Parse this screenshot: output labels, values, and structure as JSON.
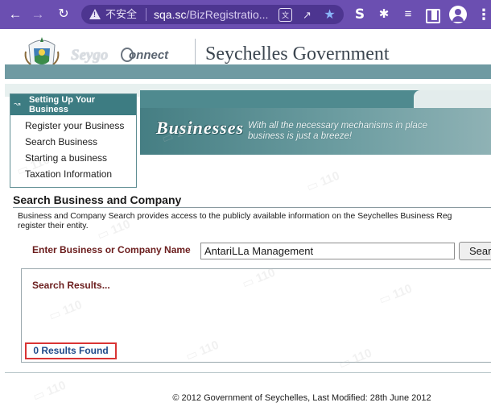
{
  "browser": {
    "insecure_label": "不安全",
    "url_host": "sqa.sc",
    "url_path": "/BizRegistratio...",
    "ext_s_glyph": "S"
  },
  "header": {
    "logo_left": "Seygo",
    "logo_right": "onnect",
    "title": "Seychelles Government"
  },
  "banner": {
    "heading": "Businesses",
    "tagline_line1": "With all the necessary mechanisms in place",
    "tagline_line2": "business is just a breeze!"
  },
  "sidebar": {
    "heading_line1": "Setting Up Your",
    "heading_line2": "Business",
    "items": [
      {
        "label": "Register your Business"
      },
      {
        "label": "Search Business"
      },
      {
        "label": "Starting a business"
      },
      {
        "label": "Taxation Information"
      }
    ]
  },
  "main": {
    "heading": "Search Business and Company",
    "intro_line1": "Business and Company Search provides access to the publicly available information on the Seychelles Business Reg",
    "intro_line2": "register their entity.",
    "field_label": "Enter Business or Company Name",
    "search_value": "AntariLLa Management",
    "search_button": "Sear",
    "results_label": "Search Results...",
    "results_found": "0 Results Found"
  },
  "footer": {
    "text": "© 2012 Government of Seychelles, Last Modified: 28th June 2012"
  },
  "colors": {
    "chrome": "#6b4fb1",
    "teal": "#3d7c82",
    "label_maroon": "#6b1d1d",
    "found_blue": "#1f4a8a",
    "highlight_red": "#d93434"
  }
}
